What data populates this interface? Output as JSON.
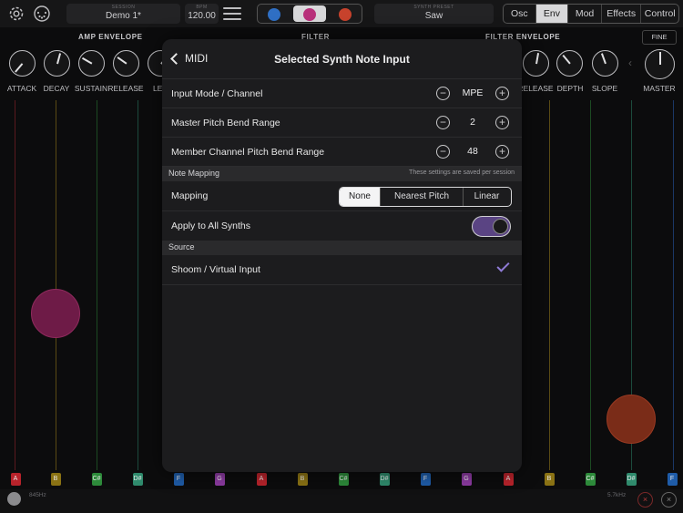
{
  "topbar": {
    "session_caption": "SESSION",
    "session_name": "Demo 1*",
    "bpm_caption": "BPM",
    "bpm_value": "120.00",
    "preset_caption": "SYNTH PRESET",
    "preset_name": "Saw",
    "synth_dots": [
      "#2f6fc4",
      "#b8307a",
      "#c7422c"
    ],
    "tabs": [
      {
        "label": "Osc",
        "active": false
      },
      {
        "label": "Env",
        "active": true
      },
      {
        "label": "Mod",
        "active": false
      },
      {
        "label": "Effects",
        "active": false
      },
      {
        "label": "Control",
        "active": false
      }
    ]
  },
  "sections": {
    "amp_envelope": "AMP ENVELOPE",
    "filter": "FILTER",
    "filter_envelope": "FILTER ENVELOPE",
    "fine": "FINE"
  },
  "knobs_left": [
    "ATTACK",
    "DECAY",
    "SUSTAIN",
    "RELEASE",
    "LEV"
  ],
  "knobs_right": [
    "RELEASE",
    "DEPTH",
    "SLOPE",
    "MASTER"
  ],
  "modal": {
    "back_label": "MIDI",
    "title": "Selected Synth Note Input",
    "rows": [
      {
        "label": "Input Mode / Channel",
        "value": "MPE"
      },
      {
        "label": "Master Pitch Bend Range",
        "value": "2"
      },
      {
        "label": "Member Channel Pitch Bend Range",
        "value": "48"
      }
    ],
    "note_mapping_header": "Note Mapping",
    "note_mapping_note": "These settings are saved per session",
    "mapping_label": "Mapping",
    "mapping_options": [
      "None",
      "Nearest Pitch",
      "Linear"
    ],
    "mapping_selected": "None",
    "apply_label": "Apply to All Synths",
    "apply_on": true,
    "source_header": "Source",
    "source_item": "Shoom / Virtual Input"
  },
  "keys": [
    "A",
    "B",
    "C#",
    "D#",
    "F",
    "G",
    "A",
    "B",
    "C#",
    "D#",
    "F",
    "G",
    "A",
    "B",
    "C#",
    "D#",
    "F"
  ],
  "key_colors": [
    "#b8232b",
    "#8a7214",
    "#2d8a3a",
    "#2f8a6c",
    "#1f5ca8",
    "#8b3aa0"
  ],
  "bottom": {
    "freq_low": "845Hz",
    "freq_high": "5.7kHz"
  }
}
